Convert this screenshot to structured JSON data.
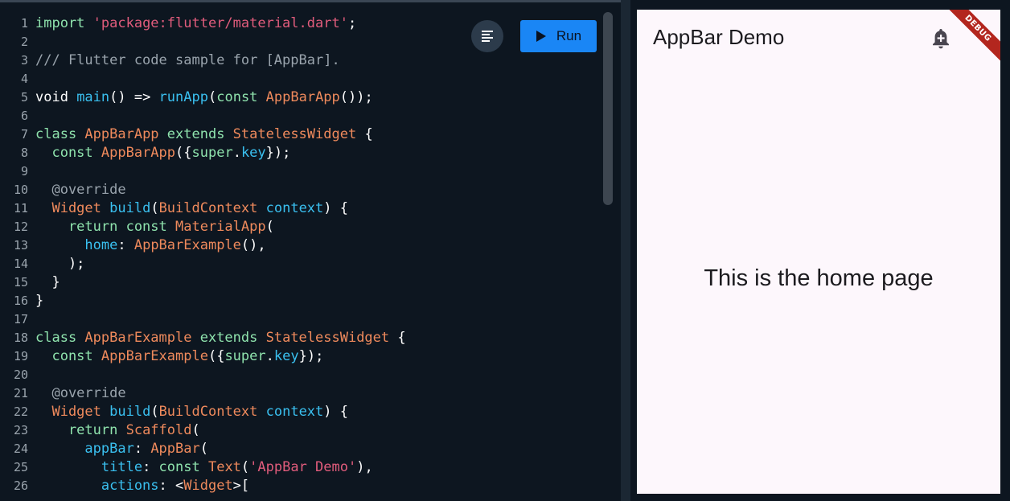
{
  "editor": {
    "run_label": "Run",
    "format_icon": "format-align-icon",
    "run_icon": "play-icon",
    "lines": [
      [
        {
          "t": "import ",
          "c": "kw"
        },
        {
          "t": "'package:flutter/material.dart'",
          "c": "str"
        },
        {
          "t": ";",
          "c": "pl"
        }
      ],
      [],
      [
        {
          "t": "/// Flutter code sample for [AppBar].",
          "c": "cm"
        }
      ],
      [],
      [
        {
          "t": "void ",
          "c": "pl"
        },
        {
          "t": "main",
          "c": "fn"
        },
        {
          "t": "() => ",
          "c": "pl"
        },
        {
          "t": "runApp",
          "c": "fn"
        },
        {
          "t": "(",
          "c": "pl"
        },
        {
          "t": "const ",
          "c": "kw"
        },
        {
          "t": "AppBarApp",
          "c": "type"
        },
        {
          "t": "());",
          "c": "pl"
        }
      ],
      [],
      [
        {
          "t": "class ",
          "c": "kw"
        },
        {
          "t": "AppBarApp ",
          "c": "type"
        },
        {
          "t": "extends ",
          "c": "kw"
        },
        {
          "t": "StatelessWidget",
          "c": "type"
        },
        {
          "t": " {",
          "c": "pl"
        }
      ],
      [
        {
          "t": "  const ",
          "c": "kw"
        },
        {
          "t": "AppBarApp",
          "c": "type"
        },
        {
          "t": "({",
          "c": "pl"
        },
        {
          "t": "super",
          "c": "kw"
        },
        {
          "t": ".",
          "c": "pl"
        },
        {
          "t": "key",
          "c": "fn"
        },
        {
          "t": "});",
          "c": "pl"
        }
      ],
      [],
      [
        {
          "t": "  @override",
          "c": "cm"
        }
      ],
      [
        {
          "t": "  Widget ",
          "c": "type"
        },
        {
          "t": "build",
          "c": "fn"
        },
        {
          "t": "(",
          "c": "pl"
        },
        {
          "t": "BuildContext ",
          "c": "type"
        },
        {
          "t": "context",
          "c": "fn"
        },
        {
          "t": ") {",
          "c": "pl"
        }
      ],
      [
        {
          "t": "    return const ",
          "c": "kw"
        },
        {
          "t": "MaterialApp",
          "c": "type"
        },
        {
          "t": "(",
          "c": "pl"
        }
      ],
      [
        {
          "t": "      home",
          "c": "fn"
        },
        {
          "t": ": ",
          "c": "pl"
        },
        {
          "t": "AppBarExample",
          "c": "type"
        },
        {
          "t": "(),",
          "c": "pl"
        }
      ],
      [
        {
          "t": "    );",
          "c": "pl"
        }
      ],
      [
        {
          "t": "  }",
          "c": "pl"
        }
      ],
      [
        {
          "t": "}",
          "c": "pl"
        }
      ],
      [],
      [
        {
          "t": "class ",
          "c": "kw"
        },
        {
          "t": "AppBarExample ",
          "c": "type"
        },
        {
          "t": "extends ",
          "c": "kw"
        },
        {
          "t": "StatelessWidget",
          "c": "type"
        },
        {
          "t": " {",
          "c": "pl"
        }
      ],
      [
        {
          "t": "  const ",
          "c": "kw"
        },
        {
          "t": "AppBarExample",
          "c": "type"
        },
        {
          "t": "({",
          "c": "pl"
        },
        {
          "t": "super",
          "c": "kw"
        },
        {
          "t": ".",
          "c": "pl"
        },
        {
          "t": "key",
          "c": "fn"
        },
        {
          "t": "});",
          "c": "pl"
        }
      ],
      [],
      [
        {
          "t": "  @override",
          "c": "cm"
        }
      ],
      [
        {
          "t": "  Widget ",
          "c": "type"
        },
        {
          "t": "build",
          "c": "fn"
        },
        {
          "t": "(",
          "c": "pl"
        },
        {
          "t": "BuildContext ",
          "c": "type"
        },
        {
          "t": "context",
          "c": "fn"
        },
        {
          "t": ") {",
          "c": "pl"
        }
      ],
      [
        {
          "t": "    return ",
          "c": "kw"
        },
        {
          "t": "Scaffold",
          "c": "type"
        },
        {
          "t": "(",
          "c": "pl"
        }
      ],
      [
        {
          "t": "      appBar",
          "c": "fn"
        },
        {
          "t": ": ",
          "c": "pl"
        },
        {
          "t": "AppBar",
          "c": "type"
        },
        {
          "t": "(",
          "c": "pl"
        }
      ],
      [
        {
          "t": "        title",
          "c": "fn"
        },
        {
          "t": ": ",
          "c": "pl"
        },
        {
          "t": "const ",
          "c": "kw"
        },
        {
          "t": "Text",
          "c": "type"
        },
        {
          "t": "(",
          "c": "pl"
        },
        {
          "t": "'AppBar Demo'",
          "c": "str"
        },
        {
          "t": "),",
          "c": "pl"
        }
      ],
      [
        {
          "t": "        actions",
          "c": "fn"
        },
        {
          "t": ": <",
          "c": "pl"
        },
        {
          "t": "Widget",
          "c": "type"
        },
        {
          "t": ">[",
          "c": "pl"
        }
      ]
    ]
  },
  "preview": {
    "appbar_title": "AppBar Demo",
    "action_icon": "add-alert-icon",
    "body_text": "This is the home page",
    "debug_banner": "DEBUG"
  },
  "colors": {
    "editor_bg": "#0d1620",
    "keyword": "#8fe3ad",
    "string": "#e15c7c",
    "type": "#ef8a5c",
    "function": "#3ac0f0",
    "comment": "#9aa4ad",
    "run_button": "#1a86f5",
    "preview_bg": "#fdf7fc",
    "debug_banner": "#b3261e"
  }
}
